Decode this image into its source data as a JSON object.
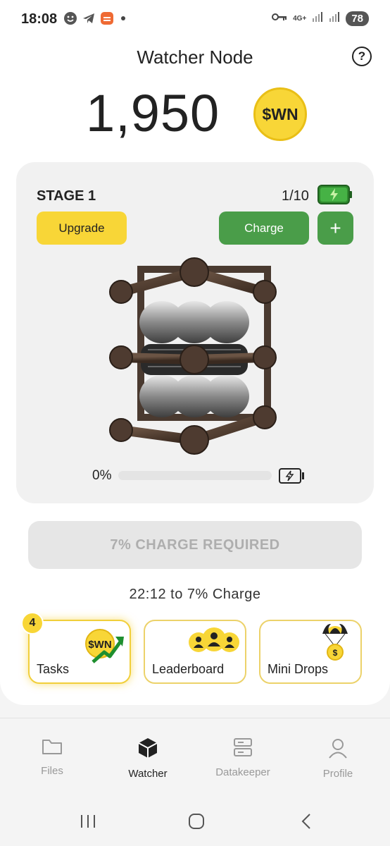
{
  "status_bar": {
    "time": "18:08",
    "network": "4G+",
    "battery": "78",
    "icons": [
      "smiley-icon",
      "telegram-icon",
      "app-icon",
      "key-icon",
      "signal-icon",
      "signal-icon"
    ]
  },
  "header": {
    "title": "Watcher Node",
    "help_icon": "?"
  },
  "balance": {
    "amount": "1,950",
    "token": "$WN"
  },
  "stage": {
    "label": "STAGE 1",
    "count": "1/10",
    "upgrade_label": "Upgrade",
    "charge_label": "Charge",
    "add_label": "+",
    "progress_text": "0%",
    "progress_value": 0
  },
  "charge_required": "7% CHARGE REQUIRED",
  "countdown": "22:12 to 7% Charge",
  "tiles": {
    "tasks": {
      "label": "Tasks",
      "badge": "4",
      "coin_text": "$WN"
    },
    "leaderboard": {
      "label": "Leaderboard"
    },
    "mini_drops": {
      "label": "Mini Drops",
      "coin_text": "$"
    }
  },
  "bottom_nav": [
    {
      "label": "Files",
      "icon": "folder-icon",
      "active": false
    },
    {
      "label": "Watcher",
      "icon": "cube-icon",
      "active": true
    },
    {
      "label": "Datakeeper",
      "icon": "server-icon",
      "active": false
    },
    {
      "label": "Profile",
      "icon": "person-icon",
      "active": false
    }
  ],
  "colors": {
    "accent_yellow": "#f8d637",
    "accent_green": "#4a9d49",
    "disabled_grey": "#e6e6e6"
  }
}
